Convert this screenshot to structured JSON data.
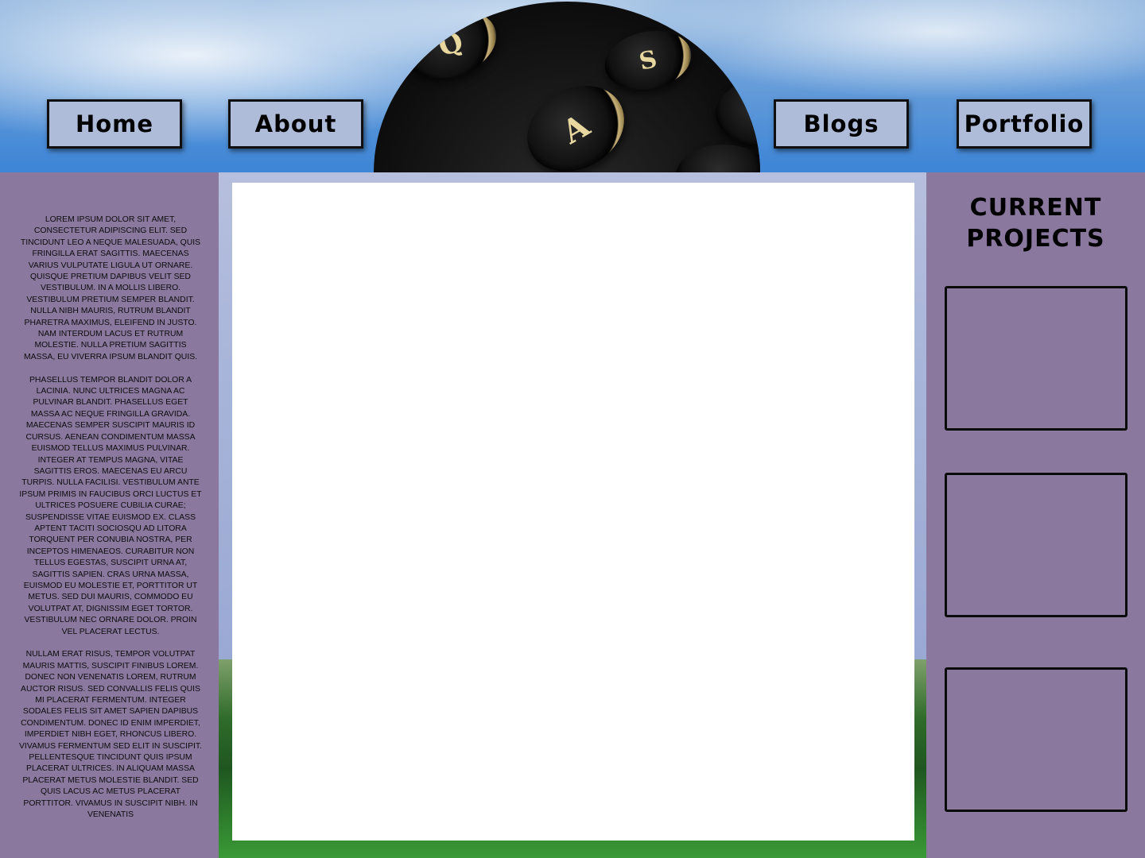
{
  "nav": {
    "home": "Home",
    "about": "About",
    "blogs": "Blogs",
    "portfolio": "Portfolio"
  },
  "hero": {
    "keys": [
      "Q",
      "S",
      "A"
    ]
  },
  "sidebar_left": {
    "paragraphs": [
      "Lorem ipsum dolor sit amet, consectetur adipiscing elit. Sed tincidunt leo a neque malesuada, quis fringilla erat sagittis. Maecenas varius vulputate ligula ut ornare. Quisque pretium dapibus velit sed vestibulum. In a mollis libero. Vestibulum pretium semper blandit. Nulla nibh mauris, rutrum blandit pharetra maximus, eleifend in justo. Nam interdum lacus et rutrum molestie. Nulla pretium sagittis massa, eu viverra ipsum blandit quis.",
      "Phasellus tempor blandit dolor a lacinia. Nunc ultrices magna ac pulvinar blandit. Phasellus eget massa ac neque fringilla gravida. Maecenas semper suscipit mauris id cursus. Aenean condimentum massa euismod tellus maximus pulvinar. Integer at tempus magna, vitae sagittis eros. Maecenas eu arcu turpis. Nulla facilisi. Vestibulum ante ipsum primis in faucibus orci luctus et ultrices posuere cubilia curae; Suspendisse vitae euismod ex. Class aptent taciti sociosqu ad litora torquent per conubia nostra, per inceptos himenaeos. Curabitur non tellus egestas, suscipit urna at, sagittis sapien. Cras urna massa, euismod eu molestie et, porttitor ut metus. Sed dui mauris, commodo eu volutpat at, dignissim eget tortor. Vestibulum nec ornare dolor. Proin vel placerat lectus.",
      "Nullam erat risus, tempor volutpat mauris mattis, suscipit finibus lorem. Donec non venenatis lorem, rutrum auctor risus. Sed convallis felis quis mi placerat fermentum. Integer sodales felis sit amet sapien dapibus condimentum. Donec id enim imperdiet, imperdiet nibh eget, rhoncus libero. Vivamus fermentum sed elit in suscipit. Pellentesque tincidunt quis ipsum placerat ultrices. In aliquam massa placerat metus molestie blandit. Sed quis lacus ac metus placerat porttitor. Vivamus in suscipit nibh. In venenatis"
    ]
  },
  "sidebar_right": {
    "title_line1": "CURRENT",
    "title_line2": "PROJECTS",
    "project_slots": 3
  },
  "colors": {
    "sidebar": "#8a789e",
    "nav_button": "#aebcd9",
    "content_band": "#a8b5da",
    "content_panel": "#ffffff"
  }
}
